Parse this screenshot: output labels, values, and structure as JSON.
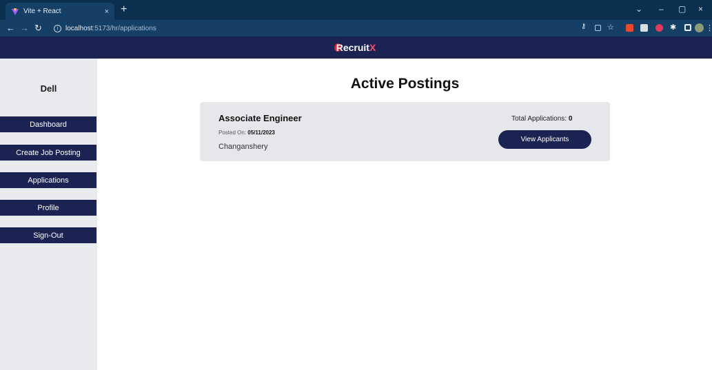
{
  "browser": {
    "tab_title": "Vite + React",
    "tab_close": "×",
    "new_tab": "+",
    "url_host": "localhost",
    "url_path": ":5173/hr/applications",
    "win_min": "–",
    "win_restore": "▢",
    "win_close": "×",
    "win_chevron": "⌄"
  },
  "app": {
    "brand_main": "Recruit",
    "brand_accent": "X",
    "company": "Dell",
    "accent_color": "#1b2352"
  },
  "sidebar": {
    "items": [
      {
        "label": "Dashboard"
      },
      {
        "label": "Create Job Posting"
      },
      {
        "label": "Applications"
      },
      {
        "label": "Profile"
      },
      {
        "label": "Sign-Out"
      }
    ]
  },
  "main": {
    "heading": "Active Postings",
    "postings": [
      {
        "title": "Associate Engineer",
        "posted_label": "Posted On:",
        "posted_date": "05/11/2023",
        "location": "Changanshery",
        "total_label": "Total Applications:",
        "total_count": "0",
        "view_button": "View Applicants"
      }
    ]
  }
}
